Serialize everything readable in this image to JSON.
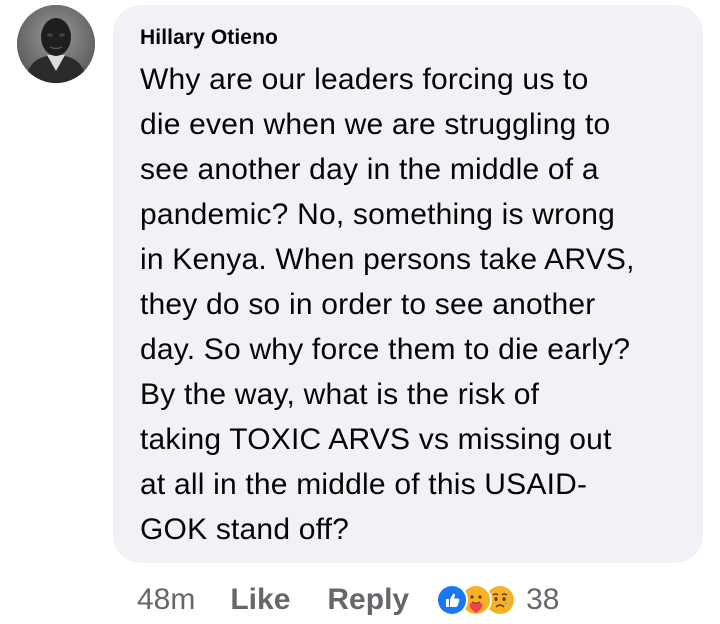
{
  "comment": {
    "author": "Hillary Otieno",
    "text": "Why are our leaders forcing us to\ndie even when we are struggling to\nsee another day in the middle of a\npandemic? No, something is wrong\nin Kenya. When persons take ARVS,\nthey do so in order to see another\nday. So why force them to die early?\nBy the way, what is the risk of\ntaking TOXIC ARVS vs missing out\nat all in the middle of this USAID-\nGOK stand off?"
  },
  "actions": {
    "time": "48m",
    "like_label": "Like",
    "reply_label": "Reply",
    "reaction_count": "38",
    "reaction_icons": [
      "like-icon",
      "care-icon",
      "sad-icon"
    ]
  },
  "colors": {
    "bubble": "#f0f2f5",
    "meta_text": "#65676b",
    "like_blue": "#1877f2",
    "emoji_yellow": "#f7b125"
  }
}
